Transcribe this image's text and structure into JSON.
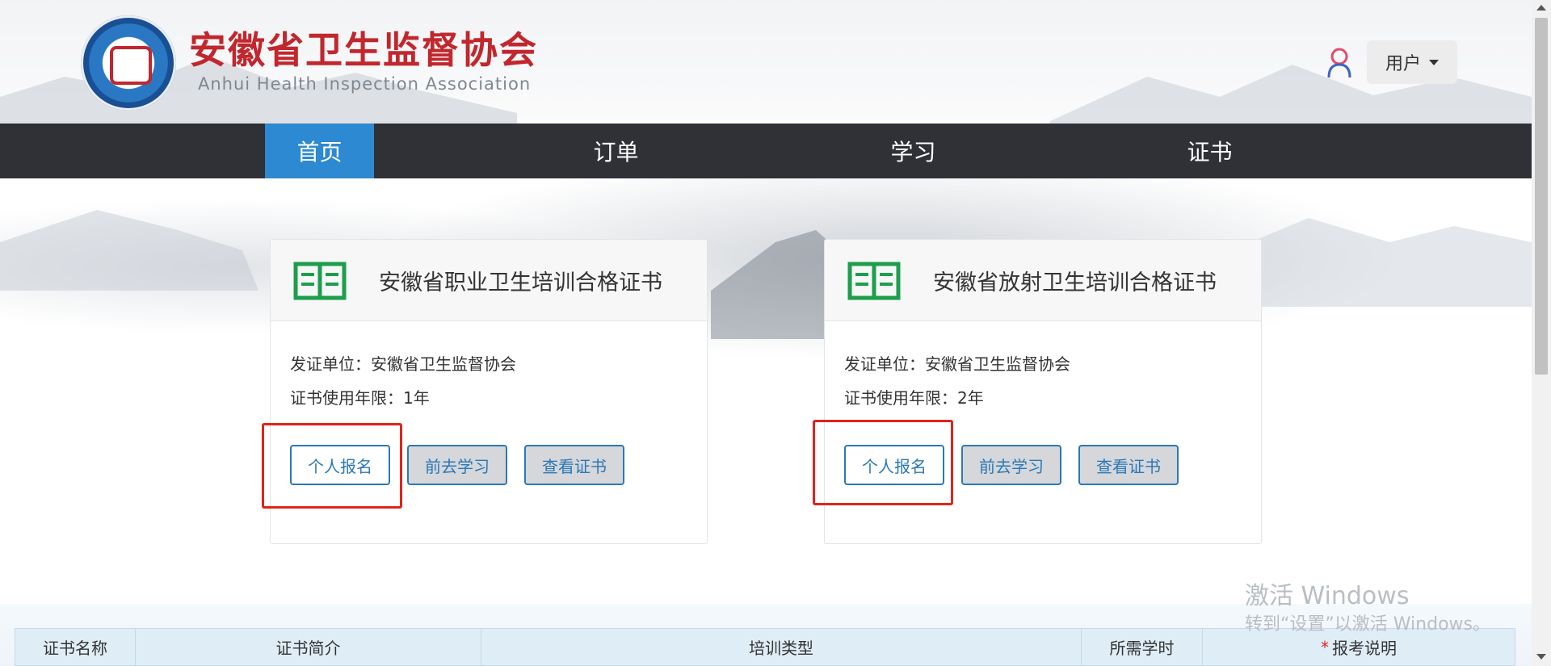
{
  "header": {
    "brand_cn": "安徽省卫生监督协会",
    "brand_en": "Anhui  Health  Inspection  Association",
    "user_label": "用户"
  },
  "nav": [
    {
      "label": "首页",
      "active": true
    },
    {
      "label": "订单",
      "active": false
    },
    {
      "label": "学习",
      "active": false
    },
    {
      "label": "证书",
      "active": false
    }
  ],
  "cards": [
    {
      "icon": "book-icon",
      "title": "安徽省职业卫生培训合格证书",
      "issuer": "发证单位：安徽省卫生监督协会",
      "validity": "证书使用年限：1年",
      "buttons": {
        "register": "个人报名",
        "study": "前去学习",
        "view": "查看证书"
      }
    },
    {
      "icon": "book-icon",
      "title": "安徽省放射卫生培训合格证书",
      "issuer": "发证单位：安徽省卫生监督协会",
      "validity": "证书使用年限：2年",
      "buttons": {
        "register": "个人报名",
        "study": "前去学习",
        "view": "查看证书"
      }
    }
  ],
  "table": {
    "columns": [
      "证书名称",
      "证书简介",
      "培训类型",
      "所需学时",
      "报考说明"
    ],
    "required_mark": "*"
  },
  "watermark": {
    "line1": "激活 Windows",
    "line2": "转到“设置”以激活 Windows。"
  },
  "colors": {
    "brand_red": "#c1272d",
    "nav_bg": "#2f3137",
    "nav_active": "#2d89d1",
    "icon_green": "#1e9e4d",
    "button_blue": "#2a78b7",
    "highlight_red": "#e2231a"
  }
}
